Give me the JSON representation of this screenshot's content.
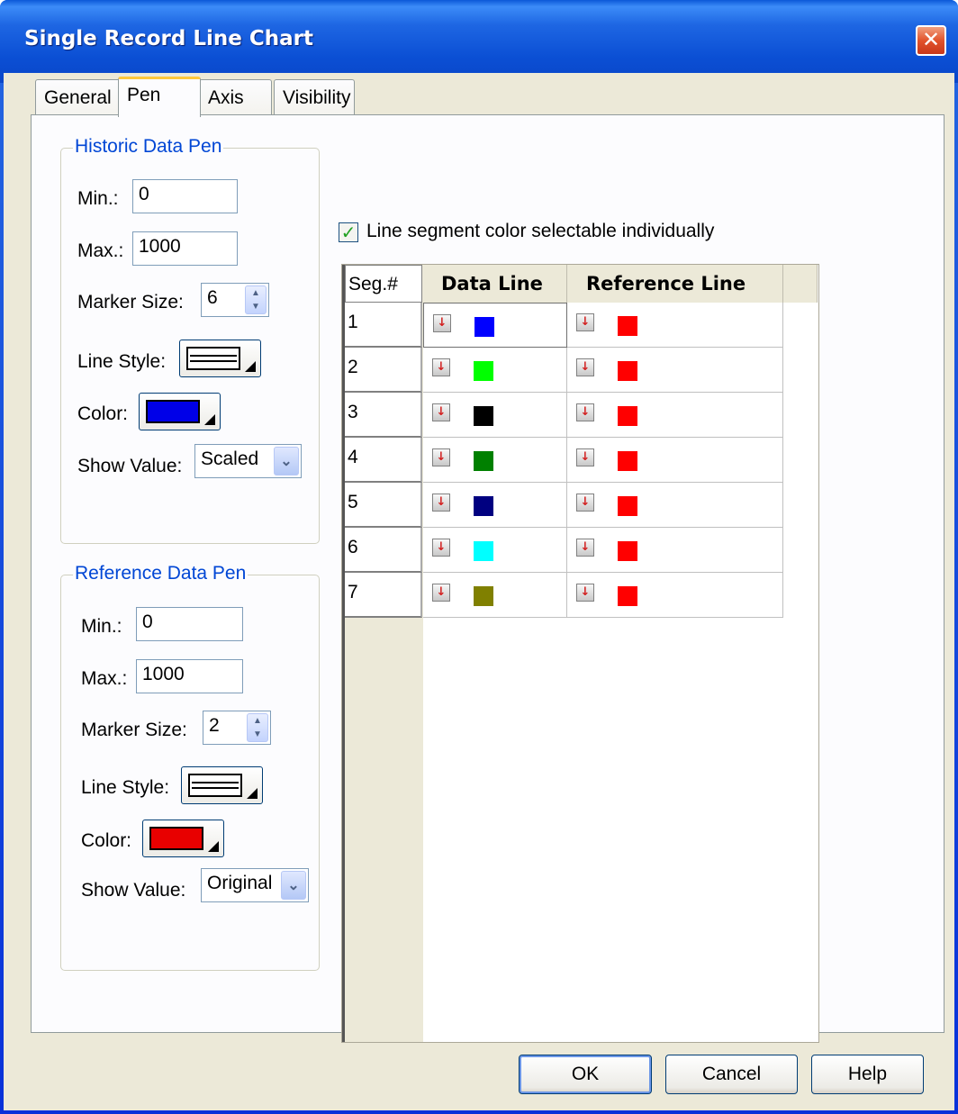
{
  "window": {
    "title": "Single Record Line Chart"
  },
  "tabs": [
    {
      "label": "General"
    },
    {
      "label": "Pen"
    },
    {
      "label": "Axis"
    },
    {
      "label": "Visibility"
    }
  ],
  "historic": {
    "legend": "Historic Data Pen",
    "min_label": "Min.:",
    "min_value": "0",
    "max_label": "Max.:",
    "max_value": "1000",
    "marker_label": "Marker Size:",
    "marker_value": "6",
    "linestyle_label": "Line Style:",
    "color_label": "Color:",
    "color": "#0000e8",
    "showvalue_label": "Show Value:",
    "showvalue_value": "Scaled"
  },
  "reference": {
    "legend": "Reference Data Pen",
    "min_label": "Min.:",
    "min_value": "0",
    "max_label": "Max.:",
    "max_value": "1000",
    "marker_label": "Marker Size:",
    "marker_value": "2",
    "linestyle_label": "Line Style:",
    "color_label": "Color:",
    "color": "#e80000",
    "showvalue_label": "Show Value:",
    "showvalue_value": "Original"
  },
  "segment_option": {
    "label": "Line segment color selectable individually",
    "checked": true
  },
  "grid": {
    "headers": {
      "seg": "Seg.#",
      "data_line": "Data Line",
      "reference_line": "Reference Line"
    },
    "rows": [
      {
        "seg": "1",
        "data_color": "#0000ff",
        "ref_color": "#ff0000"
      },
      {
        "seg": "2",
        "data_color": "#00ff00",
        "ref_color": "#ff0000"
      },
      {
        "seg": "3",
        "data_color": "#000000",
        "ref_color": "#ff0000"
      },
      {
        "seg": "4",
        "data_color": "#008000",
        "ref_color": "#ff0000"
      },
      {
        "seg": "5",
        "data_color": "#000080",
        "ref_color": "#ff0000"
      },
      {
        "seg": "6",
        "data_color": "#00ffff",
        "ref_color": "#ff0000"
      },
      {
        "seg": "7",
        "data_color": "#808000",
        "ref_color": "#ff0000"
      }
    ]
  },
  "buttons": {
    "ok": "OK",
    "cancel": "Cancel",
    "help": "Help"
  },
  "icons": {
    "close": "close-icon",
    "check": "checkmark-icon",
    "dropdown": "chevron-down-icon",
    "spin": "spinner-arrows-icon",
    "color_arrow": "down-arrow-icon"
  }
}
